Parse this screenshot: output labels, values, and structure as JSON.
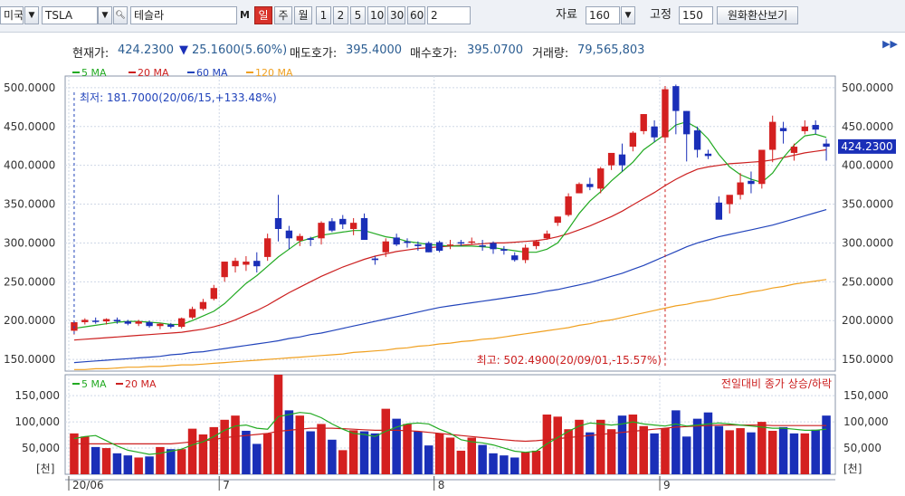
{
  "toolbar": {
    "market": "미국",
    "symbol": "TSLA",
    "name": "테슬라",
    "m_label": "M",
    "periods": [
      "일",
      "주",
      "월"
    ],
    "minutes": [
      "1",
      "2",
      "5",
      "10",
      "30",
      "60"
    ],
    "interval_value": "2",
    "data_label": "자료",
    "data_value": "160",
    "fixed_label": "고정",
    "fixed_value": "150",
    "fx_button": "원화환산보기"
  },
  "info": {
    "price_label": "현재가:",
    "price": "424.2300",
    "change": "25.1600(5.60%)",
    "ask_label": "매도호가:",
    "ask": "395.4000",
    "bid_label": "매수호가:",
    "bid": "395.0700",
    "volume_label": "거래량:",
    "volume": "79,565,803"
  },
  "colors": {
    "up": "#d42020",
    "down": "#1a2fb8",
    "ma5": "#22aa22",
    "ma20": "#cc2020",
    "ma60": "#2244bb",
    "ma120": "#f0a020",
    "grid": "#cfd8e6"
  },
  "chart_data": [
    {
      "type": "candlestick",
      "legend": [
        "5 MA",
        "20 MA",
        "60 MA",
        "120 MA"
      ],
      "ylim": [
        135,
        515
      ],
      "yticks": [
        "500.0000",
        "450.0000",
        "400.0000",
        "350.0000",
        "300.0000",
        "250.0000",
        "200.0000",
        "150.0000"
      ],
      "y_values": [
        500,
        450,
        400,
        350,
        300,
        250,
        200,
        150
      ],
      "x_labels": [
        "20/06",
        "7",
        "8",
        "9"
      ],
      "x_label_index": [
        0,
        14,
        34,
        55
      ],
      "current_price_label": "424.2300",
      "current_price": 424.23,
      "min_note": "최저: 181.7000(20/06/15,+133.48%)",
      "max_note": "최고: 502.4900(20/09/01,-15.57%)",
      "min_index": 0,
      "max_index": 55,
      "ohlc": [
        [
          187,
          200,
          182,
          198
        ],
        [
          198,
          203,
          195,
          201
        ],
        [
          200,
          204,
          196,
          199
        ],
        [
          199,
          203,
          195,
          202
        ],
        [
          201,
          204,
          196,
          199
        ],
        [
          199,
          201,
          194,
          196
        ],
        [
          196,
          201,
          193,
          199
        ],
        [
          198,
          200,
          191,
          193
        ],
        [
          193,
          197,
          189,
          196
        ],
        [
          195,
          197,
          190,
          192
        ],
        [
          192,
          204,
          190,
          203
        ],
        [
          204,
          218,
          202,
          215
        ],
        [
          215,
          228,
          213,
          224
        ],
        [
          228,
          246,
          226,
          242
        ],
        [
          256,
          276,
          250,
          276
        ],
        [
          270,
          281,
          262,
          277
        ],
        [
          272,
          283,
          264,
          276
        ],
        [
          277,
          288,
          262,
          270
        ],
        [
          282,
          312,
          277,
          306
        ],
        [
          332,
          362,
          302,
          318
        ],
        [
          316,
          322,
          292,
          306
        ],
        [
          303,
          312,
          296,
          309
        ],
        [
          306,
          308,
          296,
          304
        ],
        [
          306,
          328,
          298,
          326
        ],
        [
          328,
          332,
          314,
          316
        ],
        [
          331,
          336,
          318,
          324
        ],
        [
          318,
          332,
          310,
          326
        ],
        [
          332,
          338,
          310,
          304
        ],
        [
          280,
          283,
          272,
          278
        ],
        [
          288,
          306,
          282,
          302
        ],
        [
          307,
          312,
          296,
          298
        ],
        [
          302,
          306,
          294,
          300
        ],
        [
          298,
          302,
          290,
          296
        ],
        [
          300,
          302,
          288,
          288
        ],
        [
          301,
          303,
          288,
          290
        ],
        [
          297,
          304,
          292,
          298
        ],
        [
          301,
          304,
          296,
          300
        ],
        [
          302,
          307,
          298,
          302
        ],
        [
          297,
          304,
          290,
          296
        ],
        [
          300,
          302,
          286,
          292
        ],
        [
          292,
          296,
          285,
          290
        ],
        [
          284,
          288,
          276,
          278
        ],
        [
          278,
          298,
          274,
          294
        ],
        [
          296,
          304,
          292,
          302
        ],
        [
          306,
          316,
          304,
          312
        ],
        [
          326,
          334,
          322,
          334
        ],
        [
          336,
          364,
          334,
          360
        ],
        [
          364,
          378,
          364,
          376
        ],
        [
          376,
          384,
          368,
          372
        ],
        [
          370,
          398,
          364,
          396
        ],
        [
          400,
          412,
          394,
          416
        ],
        [
          414,
          428,
          392,
          400
        ],
        [
          424,
          444,
          418,
          442
        ],
        [
          444,
          466,
          440,
          466
        ],
        [
          450,
          458,
          430,
          436
        ],
        [
          436,
          502,
          432,
          498
        ],
        [
          502,
          504,
          440,
          470
        ],
        [
          470,
          470,
          405,
          440
        ],
        [
          445,
          450,
          410,
          420
        ],
        [
          415,
          420,
          408,
          412
        ],
        [
          352,
          360,
          336,
          330
        ],
        [
          350,
          352,
          338,
          362
        ],
        [
          362,
          390,
          356,
          378
        ],
        [
          380,
          392,
          364,
          376
        ],
        [
          376,
          420,
          370,
          420
        ],
        [
          420,
          464,
          404,
          456
        ],
        [
          448,
          456,
          428,
          444
        ],
        [
          416,
          428,
          406,
          424
        ],
        [
          444,
          458,
          440,
          450
        ],
        [
          452,
          458,
          440,
          446
        ],
        [
          428,
          434,
          406,
          424
        ]
      ],
      "ma5": [
        190,
        192,
        194,
        196,
        198,
        199,
        199,
        198,
        197,
        195,
        195,
        200,
        206,
        212,
        222,
        235,
        248,
        258,
        270,
        282,
        292,
        302,
        306,
        310,
        312,
        314,
        316,
        316,
        312,
        308,
        306,
        302,
        300,
        298,
        297,
        296,
        296,
        296,
        295,
        294,
        292,
        290,
        288,
        288,
        292,
        300,
        318,
        338,
        354,
        366,
        380,
        392,
        404,
        420,
        430,
        440,
        452,
        456,
        448,
        434,
        414,
        398,
        388,
        382,
        378,
        390,
        410,
        426,
        438,
        440,
        436
      ],
      "ma20": [
        175,
        176,
        177,
        178,
        179,
        180,
        181,
        182,
        183,
        184,
        185,
        187,
        189,
        192,
        196,
        201,
        207,
        213,
        220,
        228,
        236,
        243,
        250,
        257,
        263,
        269,
        274,
        279,
        283,
        286,
        289,
        291,
        293,
        294,
        295,
        296,
        297,
        298,
        299,
        300,
        300,
        301,
        302,
        303,
        305,
        308,
        312,
        317,
        322,
        328,
        334,
        341,
        349,
        357,
        365,
        374,
        382,
        389,
        395,
        398,
        400,
        402,
        403,
        404,
        405,
        407,
        410,
        413,
        416,
        418,
        420
      ],
      "ma60": [
        146,
        147,
        148,
        149,
        150,
        151,
        152,
        153,
        154,
        156,
        157,
        159,
        160,
        162,
        164,
        166,
        168,
        170,
        172,
        174,
        177,
        179,
        182,
        184,
        187,
        190,
        193,
        196,
        199,
        202,
        205,
        208,
        211,
        214,
        217,
        219,
        221,
        223,
        225,
        227,
        229,
        231,
        233,
        235,
        238,
        240,
        243,
        246,
        249,
        253,
        257,
        261,
        266,
        271,
        277,
        283,
        289,
        295,
        300,
        304,
        308,
        311,
        314,
        317,
        320,
        323,
        327,
        331,
        335,
        339,
        343
      ],
      "ma120": [
        137,
        137,
        138,
        138,
        139,
        140,
        140,
        141,
        141,
        142,
        143,
        143,
        144,
        145,
        146,
        147,
        148,
        149,
        150,
        151,
        152,
        153,
        154,
        155,
        156,
        157,
        159,
        160,
        161,
        162,
        164,
        165,
        167,
        168,
        170,
        171,
        173,
        174,
        176,
        177,
        179,
        181,
        183,
        185,
        187,
        189,
        191,
        194,
        196,
        199,
        201,
        204,
        207,
        210,
        213,
        216,
        219,
        221,
        224,
        226,
        229,
        232,
        234,
        237,
        239,
        242,
        244,
        247,
        249,
        251,
        253
      ]
    },
    {
      "type": "bar",
      "legend": [
        "5 MA",
        "20 MA"
      ],
      "note": "전일대비 종가 상승/하락",
      "unit_label": "[천]",
      "ylim": [
        0,
        190000
      ],
      "yticks": [
        "150,000",
        "100,000",
        "50,000"
      ],
      "y_values": [
        150000,
        100000,
        50000
      ],
      "volume": [
        78000,
        72000,
        52000,
        50000,
        40000,
        36000,
        32000,
        34000,
        52000,
        48000,
        48000,
        87000,
        76000,
        90000,
        104000,
        112000,
        83000,
        58000,
        78000,
        190000,
        122000,
        112000,
        82000,
        96000,
        66000,
        46000,
        84000,
        82000,
        78000,
        125000,
        106000,
        96000,
        82000,
        55000,
        78000,
        70000,
        45000,
        70000,
        56000,
        40000,
        36000,
        32000,
        42000,
        45000,
        114000,
        110000,
        86000,
        104000,
        80000,
        104000,
        86000,
        112000,
        114000,
        92000,
        78000,
        88000,
        122000,
        72000,
        106000,
        118000,
        92000,
        84000,
        88000,
        80000,
        100000,
        83000,
        90000,
        78000,
        78000,
        85000,
        112000
      ],
      "vol_ma5": [
        68000,
        72000,
        74000,
        64000,
        54000,
        46000,
        42000,
        38000,
        40000,
        44000,
        48000,
        56000,
        62000,
        72000,
        84000,
        92000,
        94000,
        88000,
        86000,
        110000,
        114000,
        118000,
        116000,
        108000,
        96000,
        86000,
        78000,
        76000,
        72000,
        82000,
        90000,
        96000,
        98000,
        96000,
        86000,
        78000,
        66000,
        62000,
        60000,
        56000,
        50000,
        44000,
        42000,
        44000,
        58000,
        70000,
        82000,
        92000,
        98000,
        96000,
        94000,
        96000,
        100000,
        96000,
        94000,
        92000,
        96000,
        92000,
        94000,
        96000,
        98000,
        96000,
        94000,
        92000,
        90000,
        88000,
        88000,
        86000,
        84000,
        84000,
        86000
      ],
      "vol_ma20": [
        58000,
        58000,
        58000,
        58000,
        58000,
        58000,
        58000,
        58000,
        58000,
        58000,
        60000,
        62000,
        64000,
        66000,
        70000,
        72000,
        74000,
        76000,
        78000,
        82000,
        84000,
        86000,
        88000,
        88000,
        88000,
        87000,
        86000,
        85000,
        84000,
        84000,
        84000,
        83000,
        82000,
        80000,
        78000,
        76000,
        74000,
        72000,
        70000,
        68000,
        66000,
        64000,
        63000,
        64000,
        66000,
        68000,
        70000,
        72000,
        74000,
        76000,
        78000,
        80000,
        82000,
        84000,
        86000,
        88000,
        90000,
        91000,
        92000,
        93000,
        94000,
        94000,
        94000,
        94000,
        94000,
        93000,
        93000,
        93000,
        93000,
        93000,
        93000
      ]
    }
  ]
}
